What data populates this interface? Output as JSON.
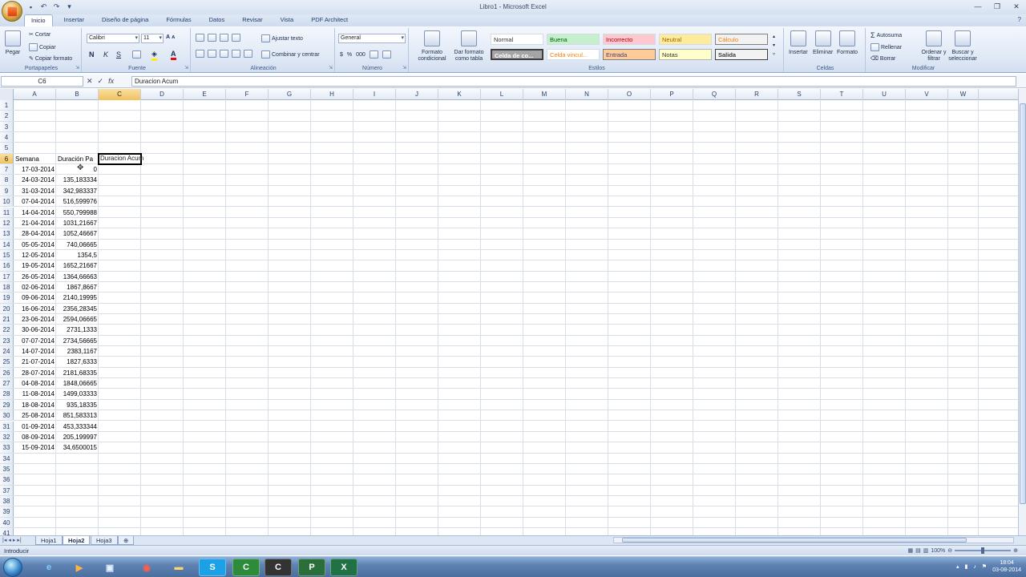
{
  "window": {
    "title": "Libro1 - Microsoft Excel",
    "qat_icons": [
      "save-icon",
      "undo-icon",
      "redo-icon",
      "customize-icon"
    ]
  },
  "tabs": [
    "Inicio",
    "Insertar",
    "Diseño de página",
    "Fórmulas",
    "Datos",
    "Revisar",
    "Vista",
    "PDF Architect"
  ],
  "ribbon": {
    "clipboard": {
      "paste": "Pegar",
      "cut": "Cortar",
      "copy": "Copiar",
      "format_painter": "Copiar formato",
      "label": "Portapapeles"
    },
    "font": {
      "name": "Calibri",
      "size": "11",
      "bold": "N",
      "italic": "K",
      "underline": "S",
      "label": "Fuente"
    },
    "alignment": {
      "wrap": "Ajustar texto",
      "merge": "Combinar y centrar",
      "label": "Alineación"
    },
    "number": {
      "format": "General",
      "currency": "$",
      "percent": "%",
      "thousands": "000",
      "label": "Número"
    },
    "styles": {
      "conditional": "Formato condicional",
      "as_table": "Dar formato como tabla",
      "cells": [
        "Normal",
        "Buena",
        "Incorrecto",
        "Neutral",
        "Cálculo",
        "Celda de co...",
        "Celda vincul...",
        "Entrada",
        "Notas",
        "Salida"
      ],
      "label": "Estilos"
    },
    "cells": {
      "insert": "Insertar",
      "delete": "Eliminar",
      "format": "Formato",
      "label": "Celdas"
    },
    "editing": {
      "autosum": "Autosuma",
      "fill": "Rellenar",
      "clear": "Borrar",
      "sort": "Ordenar y filtrar",
      "find": "Buscar y seleccionar",
      "label": "Modificar"
    }
  },
  "formula_bar": {
    "name_box": "C6",
    "content": "Duracion Acum"
  },
  "columns": [
    "A",
    "B",
    "C",
    "D",
    "E",
    "F",
    "G",
    "H",
    "I",
    "J",
    "K",
    "L",
    "M",
    "N",
    "O",
    "P",
    "Q",
    "R",
    "S",
    "T",
    "U",
    "V",
    "W"
  ],
  "selected_column": "C",
  "selected_row": 6,
  "row_numbers": [
    1,
    2,
    3,
    4,
    5,
    6,
    7,
    8,
    9,
    10,
    11,
    12,
    13,
    14,
    15,
    16,
    17,
    18,
    19,
    20,
    21,
    22,
    23,
    24,
    25,
    26,
    27,
    28,
    29,
    30,
    31,
    32,
    33,
    34,
    35,
    36,
    37,
    38,
    39,
    40,
    41
  ],
  "headers": {
    "A": "Semana",
    "B": "Duración Pa",
    "C": "Duracion Acum"
  },
  "data_rows": [
    [
      "17-03-2014",
      "0"
    ],
    [
      "24-03-2014",
      "135,183334"
    ],
    [
      "31-03-2014",
      "342,983337"
    ],
    [
      "07-04-2014",
      "516,599976"
    ],
    [
      "14-04-2014",
      "550,799988"
    ],
    [
      "21-04-2014",
      "1031,21667"
    ],
    [
      "28-04-2014",
      "1052,46667"
    ],
    [
      "05-05-2014",
      "740,06665"
    ],
    [
      "12-05-2014",
      "1354,5"
    ],
    [
      "19-05-2014",
      "1652,21667"
    ],
    [
      "26-05-2014",
      "1364,66663"
    ],
    [
      "02-06-2014",
      "1867,8667"
    ],
    [
      "09-06-2014",
      "2140,19995"
    ],
    [
      "16-06-2014",
      "2356,28345"
    ],
    [
      "23-06-2014",
      "2594,06665"
    ],
    [
      "30-06-2014",
      "2731,1333"
    ],
    [
      "07-07-2014",
      "2734,56665"
    ],
    [
      "14-07-2014",
      "2383,1167"
    ],
    [
      "21-07-2014",
      "1827,6333"
    ],
    [
      "28-07-2014",
      "2181,68335"
    ],
    [
      "04-08-2014",
      "1848,06665"
    ],
    [
      "11-08-2014",
      "1499,03333"
    ],
    [
      "18-08-2014",
      "935,18335"
    ],
    [
      "25-08-2014",
      "851,583313"
    ],
    [
      "01-09-2014",
      "453,333344"
    ],
    [
      "08-09-2014",
      "205,199997"
    ],
    [
      "15-09-2014",
      "34,6500015"
    ]
  ],
  "sheets": [
    "Hoja1",
    "Hoja2",
    "Hoja3"
  ],
  "active_sheet": "Hoja2",
  "status": {
    "mode": "Introducir",
    "zoom": "100%"
  },
  "taskbar": {
    "apps": [
      "ie-icon",
      "media-player-icon",
      "explorer-icon",
      "chrome-icon",
      "folder-icon",
      "skype-icon",
      "camtasia-icon",
      "camtasia-recorder-icon",
      "pdf-architect-icon",
      "excel-icon"
    ],
    "time": "18:04",
    "date": "03-08-2014"
  }
}
